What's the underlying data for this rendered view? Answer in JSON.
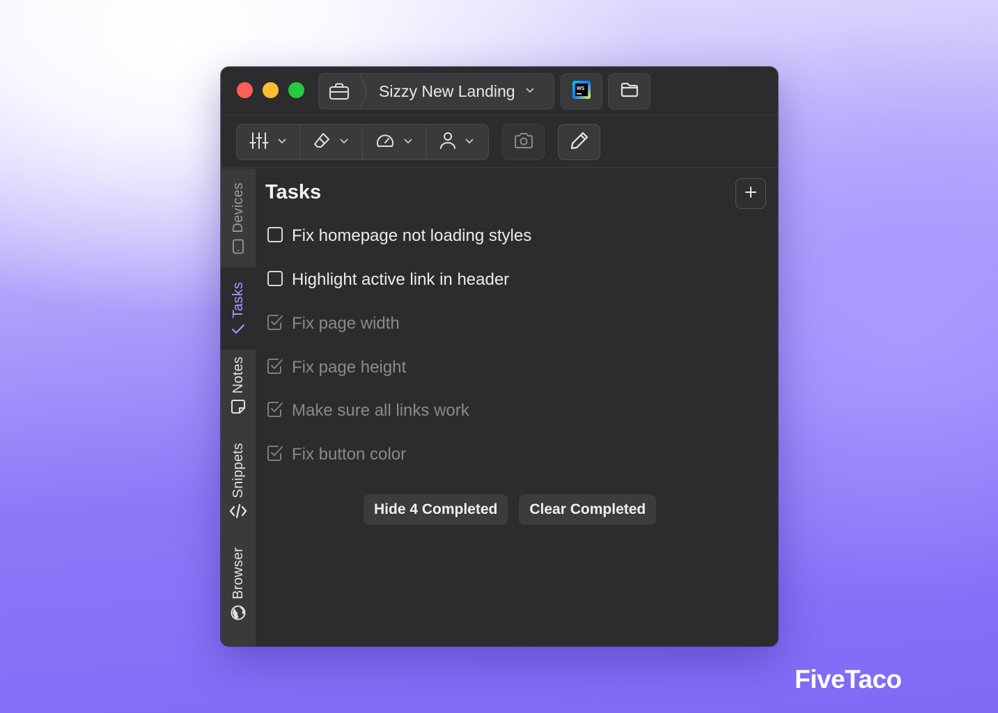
{
  "window": {
    "project_name": "Sizzy New Landing"
  },
  "sidebar": {
    "tabs": [
      {
        "label": "Devices",
        "icon": "device-icon"
      },
      {
        "label": "Tasks",
        "icon": "check-icon"
      },
      {
        "label": "Notes",
        "icon": "note-icon"
      },
      {
        "label": "Snippets",
        "icon": "code-icon"
      },
      {
        "label": "Browser",
        "icon": "globe-icon"
      }
    ]
  },
  "tasks": {
    "title": "Tasks",
    "items": [
      {
        "label": "Fix homepage not loading styles",
        "done": false
      },
      {
        "label": "Highlight active link in header",
        "done": false
      },
      {
        "label": "Fix page width",
        "done": true
      },
      {
        "label": "Fix page height",
        "done": true
      },
      {
        "label": "Make sure all links work",
        "done": true
      },
      {
        "label": "Fix button color",
        "done": true
      }
    ],
    "hide_completed_label": "Hide 4 Completed",
    "clear_completed_label": "Clear Completed"
  },
  "brand": "FiveTaco",
  "colors": {
    "accent": "#a99cff",
    "window_bg": "#2c2c2e",
    "close": "#ff5f57",
    "minimize": "#febc2e",
    "zoom": "#28c840"
  }
}
